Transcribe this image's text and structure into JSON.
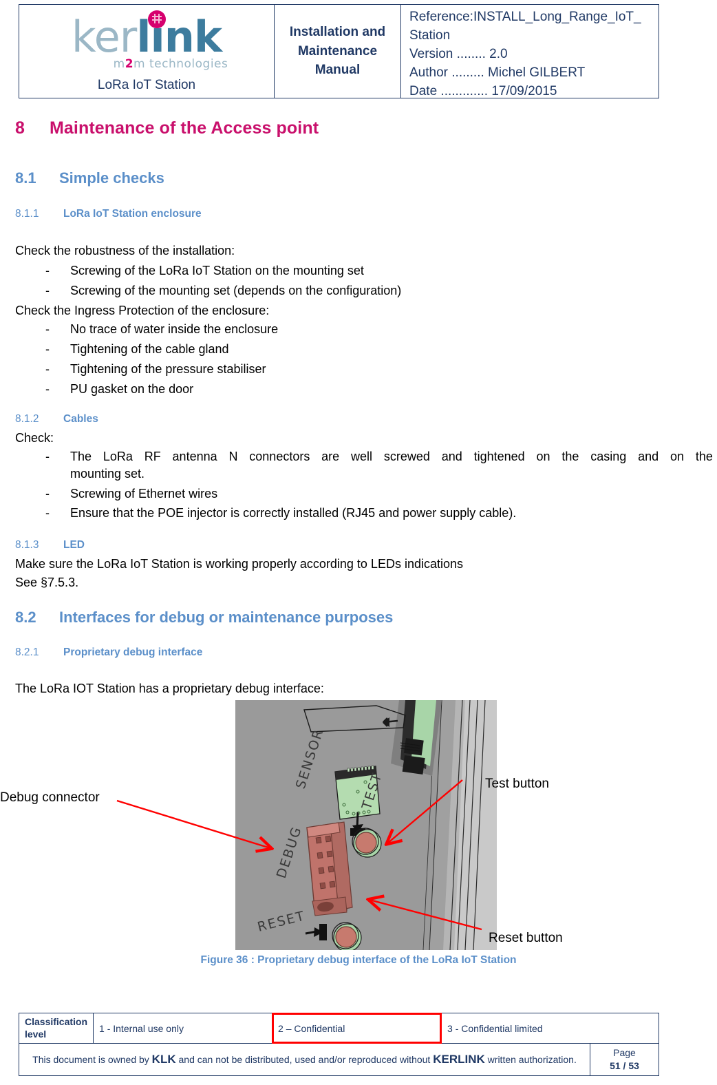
{
  "header": {
    "logo": {
      "part1": "ker",
      "part2": "link",
      "tagline_pre": "m",
      "tagline_mid": "2",
      "tagline_post": "m technologies",
      "product": "LoRa IoT Station"
    },
    "doc_title": "Installation and Maintenance Manual",
    "meta": {
      "reference_line1": "Reference:INSTALL_Long_Range_IoT_",
      "reference_line2": "Station",
      "version": "Version ........ 2.0",
      "author": "Author ......... Michel GILBERT",
      "date": "Date ............. 17/09/2015"
    }
  },
  "sections": {
    "s8": {
      "num": "8",
      "title": "Maintenance of the Access point"
    },
    "s81": {
      "num": "8.1",
      "title": "Simple checks"
    },
    "s811": {
      "num": "8.1.1",
      "title": "LoRa IoT Station enclosure"
    },
    "s812": {
      "num": "8.1.2",
      "title": "Cables"
    },
    "s813": {
      "num": "8.1.3",
      "title": "LED"
    },
    "s82": {
      "num": "8.2",
      "title": "Interfaces for debug or maintenance purposes"
    },
    "s821": {
      "num": "8.2.1",
      "title": "Proprietary debug interface"
    }
  },
  "body": {
    "check_robustness": "Check the robustness of the installation:",
    "b1": "Screwing of the LoRa IoT Station on the mounting set",
    "b2": "Screwing of the mounting set (depends on the configuration)",
    "check_ingress": "Check the Ingress Protection of the enclosure:",
    "b3": "No trace of water inside the enclosure",
    "b4": "Tightening of the cable gland",
    "b5": "Tightening of the pressure stabiliser",
    "b6": "PU gasket on the door",
    "check": "Check:",
    "cb1_w1": "The",
    "cb1_w2": "LoRa",
    "cb1_w3": "RF",
    "cb1_w4": "antenna",
    "cb1_w5": "N",
    "cb1_w6": "connectors",
    "cb1_w7": "are",
    "cb1_w8": "well",
    "cb1_w9": "screwed",
    "cb1_w10": "and",
    "cb1_w11": "tightened",
    "cb1_w12": "on",
    "cb1_w13": "the",
    "cb1_w14": "casing",
    "cb1_w15": "and",
    "cb1_w16": "on",
    "cb1_w17": "the",
    "cb1_line2": "mounting set.",
    "cb2": "Screwing of Ethernet wires",
    "cb3": "Ensure that the POE injector is correctly installed (RJ45 and power supply cable).",
    "led_line1": "Make sure the LoRa IoT Station is working properly according to LEDs indications",
    "led_line2": "See §7.5.3.",
    "intro_debug": "The LoRa IOT Station has a proprietary debug interface:",
    "dash": "-"
  },
  "figure": {
    "callout_debug": "Debug connector",
    "callout_test": "Test button",
    "callout_reset": "Reset button",
    "caption": "Figure 36 : Proprietary debug interface of the LoRa IoT Station",
    "labels": {
      "sensor": "SENSOR",
      "test": "TEST",
      "debug": "DEBUG",
      "reset": "RESET"
    }
  },
  "footer": {
    "classification_label": "Classification level",
    "level1": "1 - Internal use only",
    "level2": "2 – Confidential",
    "level3": "3 - Confidential limited",
    "owner_pre": "This document is owned by ",
    "owner_klk": "KLK",
    "owner_mid": " and can not be distributed, used and/or reproduced  without ",
    "owner_kerlink": "KERLINK",
    "owner_post": " written authorization.",
    "page_label": "Page",
    "page_value": "51 / 53"
  },
  "colors": {
    "brand_magenta": "#C9106C",
    "brand_blue": "#5B8FC9",
    "navy": "#1F3864",
    "logo_light": "#9BB7C6",
    "logo_dark": "#3D7C9E",
    "accent_red": "#FF0000"
  }
}
